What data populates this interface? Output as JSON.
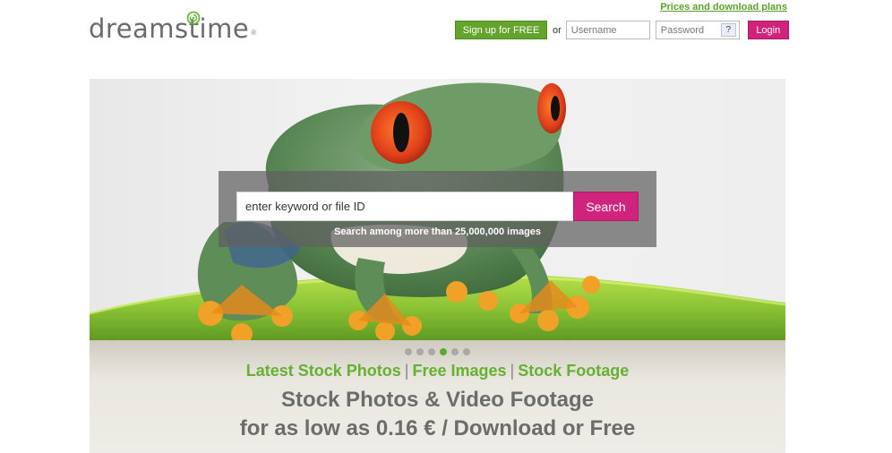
{
  "header": {
    "logo_text": "dreamstime",
    "logo_reg": "®",
    "prices_link": "Prices and download plans",
    "signup_label": "Sign up for FREE",
    "or_text": "or",
    "username_placeholder": "Username",
    "password_placeholder": "Password",
    "help_label": "?",
    "login_label": "Login"
  },
  "search": {
    "placeholder": "enter keyword or file ID",
    "button_label": "Search",
    "caption": "Search among more than 25,000,000 images"
  },
  "carousel": {
    "dot_count": 6,
    "active_index": 3
  },
  "links": {
    "latest": "Latest Stock Photos",
    "separator": "|",
    "free": "Free Images",
    "footage": "Stock Footage"
  },
  "headline": {
    "line1": "Stock Photos & Video Footage",
    "line2": "for as low as 0.16 € / Download or Free"
  },
  "colors": {
    "brand_green": "#64a42d",
    "brand_pink": "#d0247c",
    "link_green": "#66b032"
  }
}
